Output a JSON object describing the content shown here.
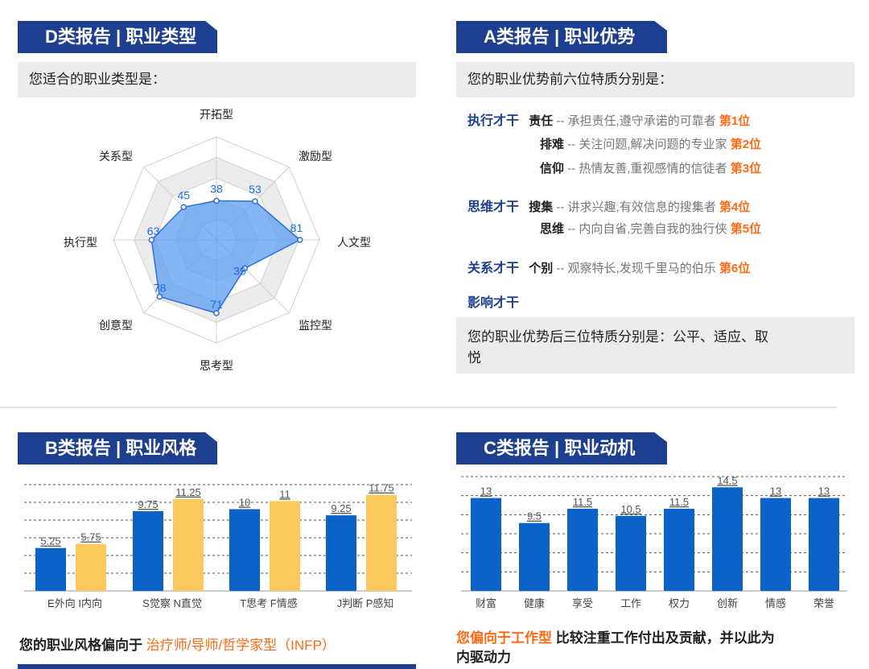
{
  "d_report": {
    "header": "D类报告 | 职业类型",
    "prompt": "您适合的职业类型是：",
    "labels": [
      "开拓型",
      "激励型",
      "人文型",
      "监控型",
      "思考型",
      "创意型",
      "执行型",
      "关系型"
    ]
  },
  "a_report": {
    "header": "A类报告 | 职业优势",
    "prompt": "您的职业优势前六位特质分别是：",
    "groups": [
      {
        "category": "执行才干",
        "items": [
          {
            "name": "责任",
            "desc": "-- 承担责任,遵守承诺的可靠者",
            "rank": "第1位"
          },
          {
            "name": "排难",
            "desc": "-- 关注问题,解决问题的专业家",
            "rank": "第2位"
          },
          {
            "name": "信仰",
            "desc": "-- 热情友善,重视感情的信徒者",
            "rank": "第3位"
          }
        ]
      },
      {
        "category": "思维才干",
        "items": [
          {
            "name": "搜集",
            "desc": "-- 讲求兴趣,有效信息的搜集者",
            "rank": "第4位"
          },
          {
            "name": "思维",
            "desc": "-- 内向自省,完善自我的独行侠",
            "rank": "第5位"
          }
        ]
      },
      {
        "category": "关系才干",
        "items": [
          {
            "name": "个别",
            "desc": "-- 观察特长,发现千里马的伯乐",
            "rank": "第6位"
          }
        ]
      },
      {
        "category": "影响才干",
        "items": []
      }
    ],
    "bottom_line1": "您的职业优势后三位特质分别是：公平、适应、取",
    "bottom_line2": "悦"
  },
  "b_report": {
    "header": "B类报告 | 职业风格",
    "summary_prefix": "您的职业风格偏向于 ",
    "summary_highlight": "治疗师/导师/哲学家型（INFP）"
  },
  "c_report": {
    "header": "C类报告 | 职业动机",
    "summary_highlight": "您偏向于工作型",
    "summary_rest": " 比较注重工作付出及贡献，并以此为",
    "summary_line2": "内驱动力"
  },
  "colors": {
    "navy": "#1d3f8f",
    "blue": "#0b63c9",
    "yellow": "#fcc95c",
    "orange": "#ff6a13",
    "radar_fill": "#5b9cf0"
  },
  "chart_data": [
    {
      "type": "radar",
      "axes": [
        "开拓型",
        "激励型",
        "人文型",
        "监控型",
        "思考型",
        "创意型",
        "执行型",
        "关系型"
      ],
      "values": [
        38,
        53,
        81,
        39,
        71,
        78,
        63,
        45
      ],
      "range": [
        0,
        100
      ]
    },
    {
      "type": "bar",
      "categories": [
        "E外向",
        "I内向",
        "S觉察",
        "N直觉",
        "T思考",
        "F情感",
        "J判断",
        "P感知"
      ],
      "values": [
        5.25,
        5.75,
        9.75,
        11.25,
        10,
        11,
        9.25,
        11.75
      ],
      "value_labels": [
        "5.25",
        "5.75",
        "9.75",
        "11.25",
        "10",
        "11",
        "9.25",
        "11.75"
      ],
      "tick_labels": [
        "E外向 I内向",
        "S觉察 N直觉",
        "T思考 F情感",
        "J判断 P感知"
      ],
      "bar_colors": [
        "blue",
        "yellow",
        "blue",
        "yellow",
        "blue",
        "yellow",
        "blue",
        "yellow"
      ],
      "ylim": [
        0,
        13
      ]
    },
    {
      "type": "bar",
      "categories": [
        "财富",
        "健康",
        "享受",
        "工作",
        "权力",
        "创新",
        "情感",
        "荣誉"
      ],
      "values": [
        13,
        9.5,
        11.5,
        10.5,
        11.5,
        14.5,
        13,
        13
      ],
      "value_labels": [
        "13",
        "9.5",
        "11.5",
        "10.5",
        "11.5",
        "14.5",
        "13",
        "13"
      ],
      "ylim": [
        0,
        16
      ]
    }
  ]
}
